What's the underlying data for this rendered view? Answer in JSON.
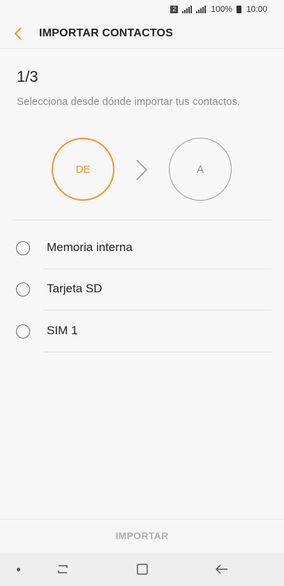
{
  "status_bar": {
    "sim_badge": "2",
    "battery": "100%",
    "time": "10:00"
  },
  "header": {
    "title": "IMPORTAR CONTACTOS",
    "back_icon": "chevron-left-icon"
  },
  "main": {
    "step": "1/3",
    "subtitle": "Selecciona desde dónde importar tus contactos.",
    "from_label": "DE",
    "to_label": "A",
    "options": [
      {
        "label": "Memoria interna",
        "selected": false
      },
      {
        "label": "Tarjeta SD",
        "selected": false
      },
      {
        "label": "SIM 1",
        "selected": false
      }
    ]
  },
  "footer": {
    "import_label": "IMPORTAR"
  },
  "navigation": {
    "recents_icon": "recents-icon",
    "home_icon": "home-icon",
    "back_icon": "back-arrow-icon"
  },
  "colors": {
    "accent": "#f0932e",
    "disabled": "#b0b0b0",
    "background": "#f7f7f7"
  }
}
